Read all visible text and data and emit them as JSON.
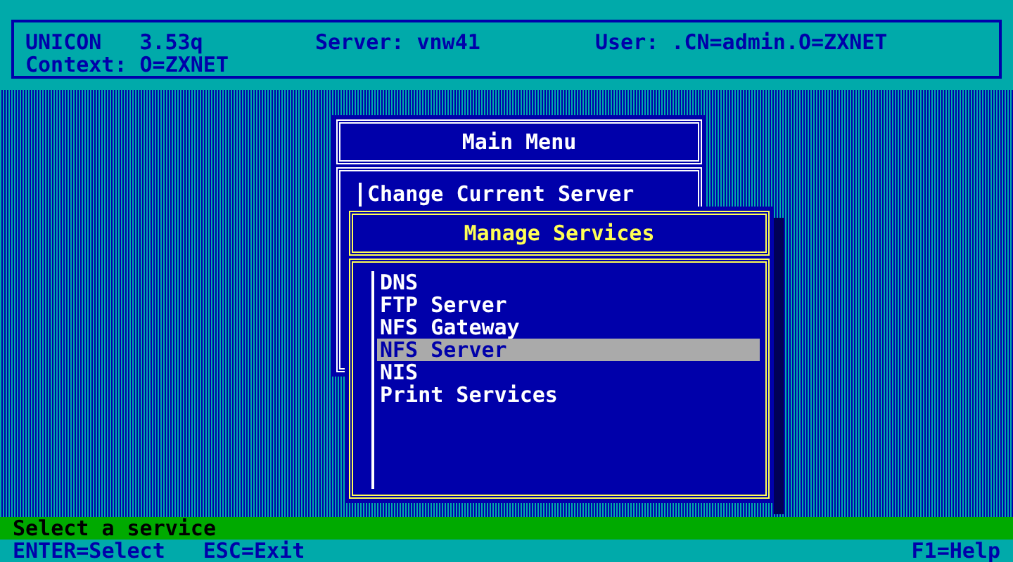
{
  "header": {
    "product": "UNICON",
    "version": "3.53q",
    "server": "Server: vnw41",
    "user": "User: .CN=admin.O=ZXNET",
    "context": "Context: O=ZXNET"
  },
  "main_menu": {
    "title": "Main Menu",
    "items": [
      {
        "label": "Change Current Server",
        "selected": false
      }
    ]
  },
  "submenu": {
    "title": "Manage Services",
    "items": [
      {
        "label": "DNS",
        "selected": false
      },
      {
        "label": "FTP Server",
        "selected": false
      },
      {
        "label": "NFS Gateway",
        "selected": false
      },
      {
        "label": "NFS Server",
        "selected": true
      },
      {
        "label": "NIS",
        "selected": false
      },
      {
        "label": "Print Services",
        "selected": false
      }
    ]
  },
  "status_line": "Select a service",
  "keys": [
    "ENTER=Select",
    "ESC=Exit"
  ],
  "help_key": "F1=Help"
}
